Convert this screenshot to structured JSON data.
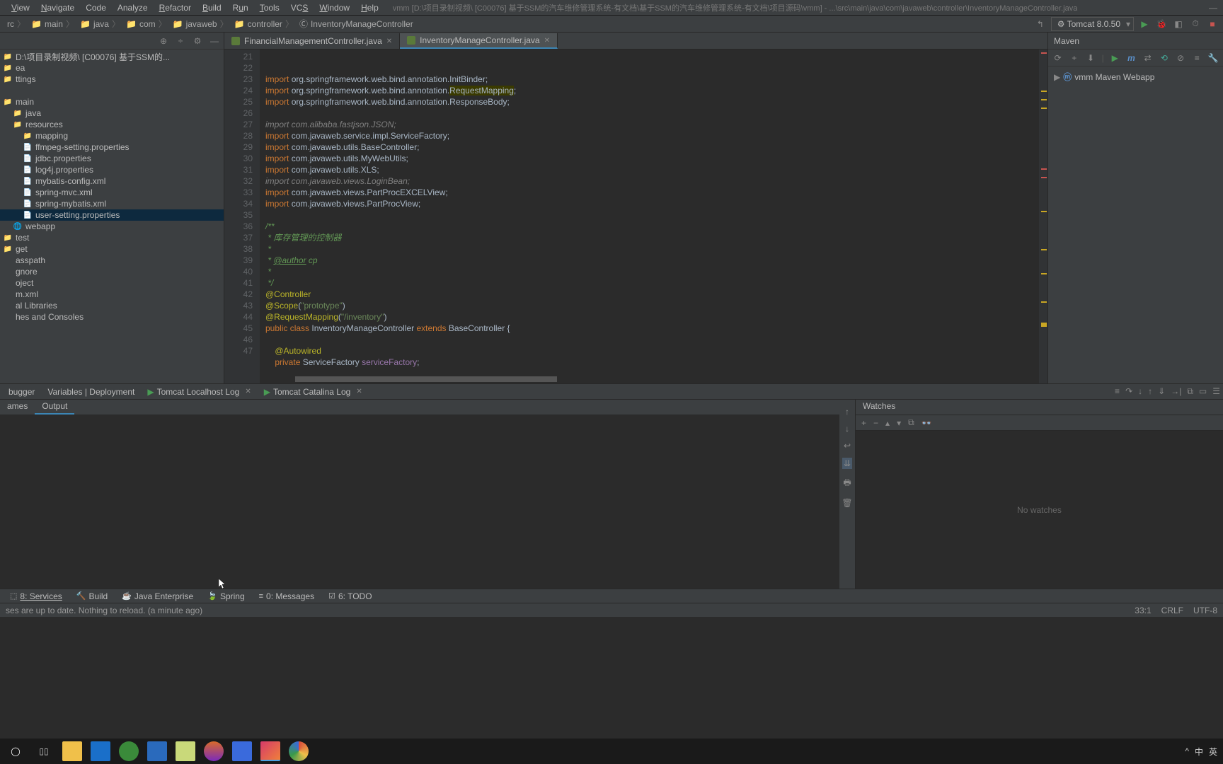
{
  "menu": [
    "View",
    "Navigate",
    "Code",
    "Analyze",
    "Refactor",
    "Build",
    "Run",
    "Tools",
    "VCS",
    "Window",
    "Help"
  ],
  "title_path": "vmm [D:\\项目录制视频\\ [C00076]  基于SSM的汽车维修管理系统-有文档\\基于SSM的汽车维修管理系统-有文档\\项目源码\\vmm] - ...\\src\\main\\java\\com\\javaweb\\controller\\InventoryManageController.java",
  "breadcrumbs": [
    "rc",
    "main",
    "java",
    "com",
    "javaweb",
    "controller",
    "InventoryManageController"
  ],
  "run_config": "Tomcat 8.0.50",
  "tree": [
    {
      "indent": 0,
      "label": "D:\\项目录制视频\\ [C00076]  基于SSM的...",
      "icon": "folder"
    },
    {
      "indent": 0,
      "label": "ea",
      "icon": "folder"
    },
    {
      "indent": 0,
      "label": "ttings",
      "icon": "folder"
    },
    {
      "indent": 0,
      "label": "",
      "icon": ""
    },
    {
      "indent": 0,
      "label": "main",
      "icon": "folder-blue"
    },
    {
      "indent": 1,
      "label": "java",
      "icon": "folder-blue"
    },
    {
      "indent": 1,
      "label": "resources",
      "icon": "folder-res"
    },
    {
      "indent": 2,
      "label": "mapping",
      "icon": "folder"
    },
    {
      "indent": 2,
      "label": "ffmpeg-setting.properties",
      "icon": "file"
    },
    {
      "indent": 2,
      "label": "jdbc.properties",
      "icon": "file"
    },
    {
      "indent": 2,
      "label": "log4j.properties",
      "icon": "file"
    },
    {
      "indent": 2,
      "label": "mybatis-config.xml",
      "icon": "file"
    },
    {
      "indent": 2,
      "label": "spring-mvc.xml",
      "icon": "file"
    },
    {
      "indent": 2,
      "label": "spring-mybatis.xml",
      "icon": "file"
    },
    {
      "indent": 2,
      "label": "user-setting.properties",
      "icon": "file",
      "selected": true
    },
    {
      "indent": 1,
      "label": "webapp",
      "icon": "folder-web"
    },
    {
      "indent": 0,
      "label": "test",
      "icon": "folder"
    },
    {
      "indent": 0,
      "label": "get",
      "icon": "folder"
    },
    {
      "indent": 0,
      "label": "asspath",
      "icon": "text"
    },
    {
      "indent": 0,
      "label": "gnore",
      "icon": "text"
    },
    {
      "indent": 0,
      "label": "oject",
      "icon": "text"
    },
    {
      "indent": 0,
      "label": "m.xml",
      "icon": "text"
    },
    {
      "indent": 0,
      "label": "al Libraries",
      "icon": "text"
    },
    {
      "indent": 0,
      "label": "hes and Consoles",
      "icon": "text"
    }
  ],
  "editor_tabs": [
    {
      "label": "FinancialManagementController.java",
      "active": false
    },
    {
      "label": "InventoryManageController.java",
      "active": true
    }
  ],
  "code_start": 21,
  "code": [
    {
      "t": "import",
      "c": "org.springframework.web.bind.annotation.InitBinder;"
    },
    {
      "t": "import",
      "c": "org.springframework.web.bind.annotation.",
      "h": "RequestMapping",
      ";": true
    },
    {
      "t": "import",
      "c": "org.springframework.web.bind.annotation.ResponseBody;"
    },
    {
      "t": "blank"
    },
    {
      "t": "cimport",
      "c": "com.alibaba.fastjson.JSON;"
    },
    {
      "t": "import",
      "c": "com.javaweb.service.impl.ServiceFactory;"
    },
    {
      "t": "import",
      "c": "com.javaweb.utils.BaseController;"
    },
    {
      "t": "import",
      "c": "com.javaweb.utils.MyWebUtils;"
    },
    {
      "t": "import",
      "c": "com.javaweb.utils.XLS;"
    },
    {
      "t": "cimport",
      "c": "com.javaweb.views.LoginBean;"
    },
    {
      "t": "import",
      "c": "com.javaweb.views.PartProcEXCELView;"
    },
    {
      "t": "import",
      "c": "com.javaweb.views.PartProcView;"
    },
    {
      "t": "blank"
    },
    {
      "t": "doc",
      "c": "/**"
    },
    {
      "t": "doc",
      "c": " * 库存管理的控制器"
    },
    {
      "t": "doc",
      "c": " *"
    },
    {
      "t": "doctag",
      "c": " * @author cp"
    },
    {
      "t": "doc",
      "c": " *"
    },
    {
      "t": "doc",
      "c": " */"
    },
    {
      "t": "anno",
      "c": "@Controller"
    },
    {
      "t": "annoarg",
      "a": "@Scope",
      "s": "\"prototype\""
    },
    {
      "t": "annoarg",
      "a": "@RequestMapping",
      "s": "\"/inventory\""
    },
    {
      "t": "class",
      "c": "public class InventoryManageController extends BaseController {"
    },
    {
      "t": "blank"
    },
    {
      "t": "anno2",
      "c": "    @Autowired"
    },
    {
      "t": "field",
      "c": "    private ServiceFactory serviceFactory;"
    },
    {
      "t": "blank"
    }
  ],
  "maven": {
    "title": "Maven",
    "project": "vmm Maven Webapp"
  },
  "debug_tabs": [
    "bugger",
    "Variables | Deployment",
    "Tomcat Localhost Log",
    "Tomcat Catalina Log"
  ],
  "frames_tabs": [
    "ames",
    "Output"
  ],
  "watches": {
    "title": "Watches",
    "empty": "No watches"
  },
  "tool_windows": [
    "8: Services",
    "Build",
    "Java Enterprise",
    "Spring",
    "0: Messages",
    "6: TODO"
  ],
  "status_msg": "ses are up to date. Nothing to reload. (a minute ago)",
  "status_right": [
    "33:1",
    "CRLF",
    "UTF-8"
  ]
}
